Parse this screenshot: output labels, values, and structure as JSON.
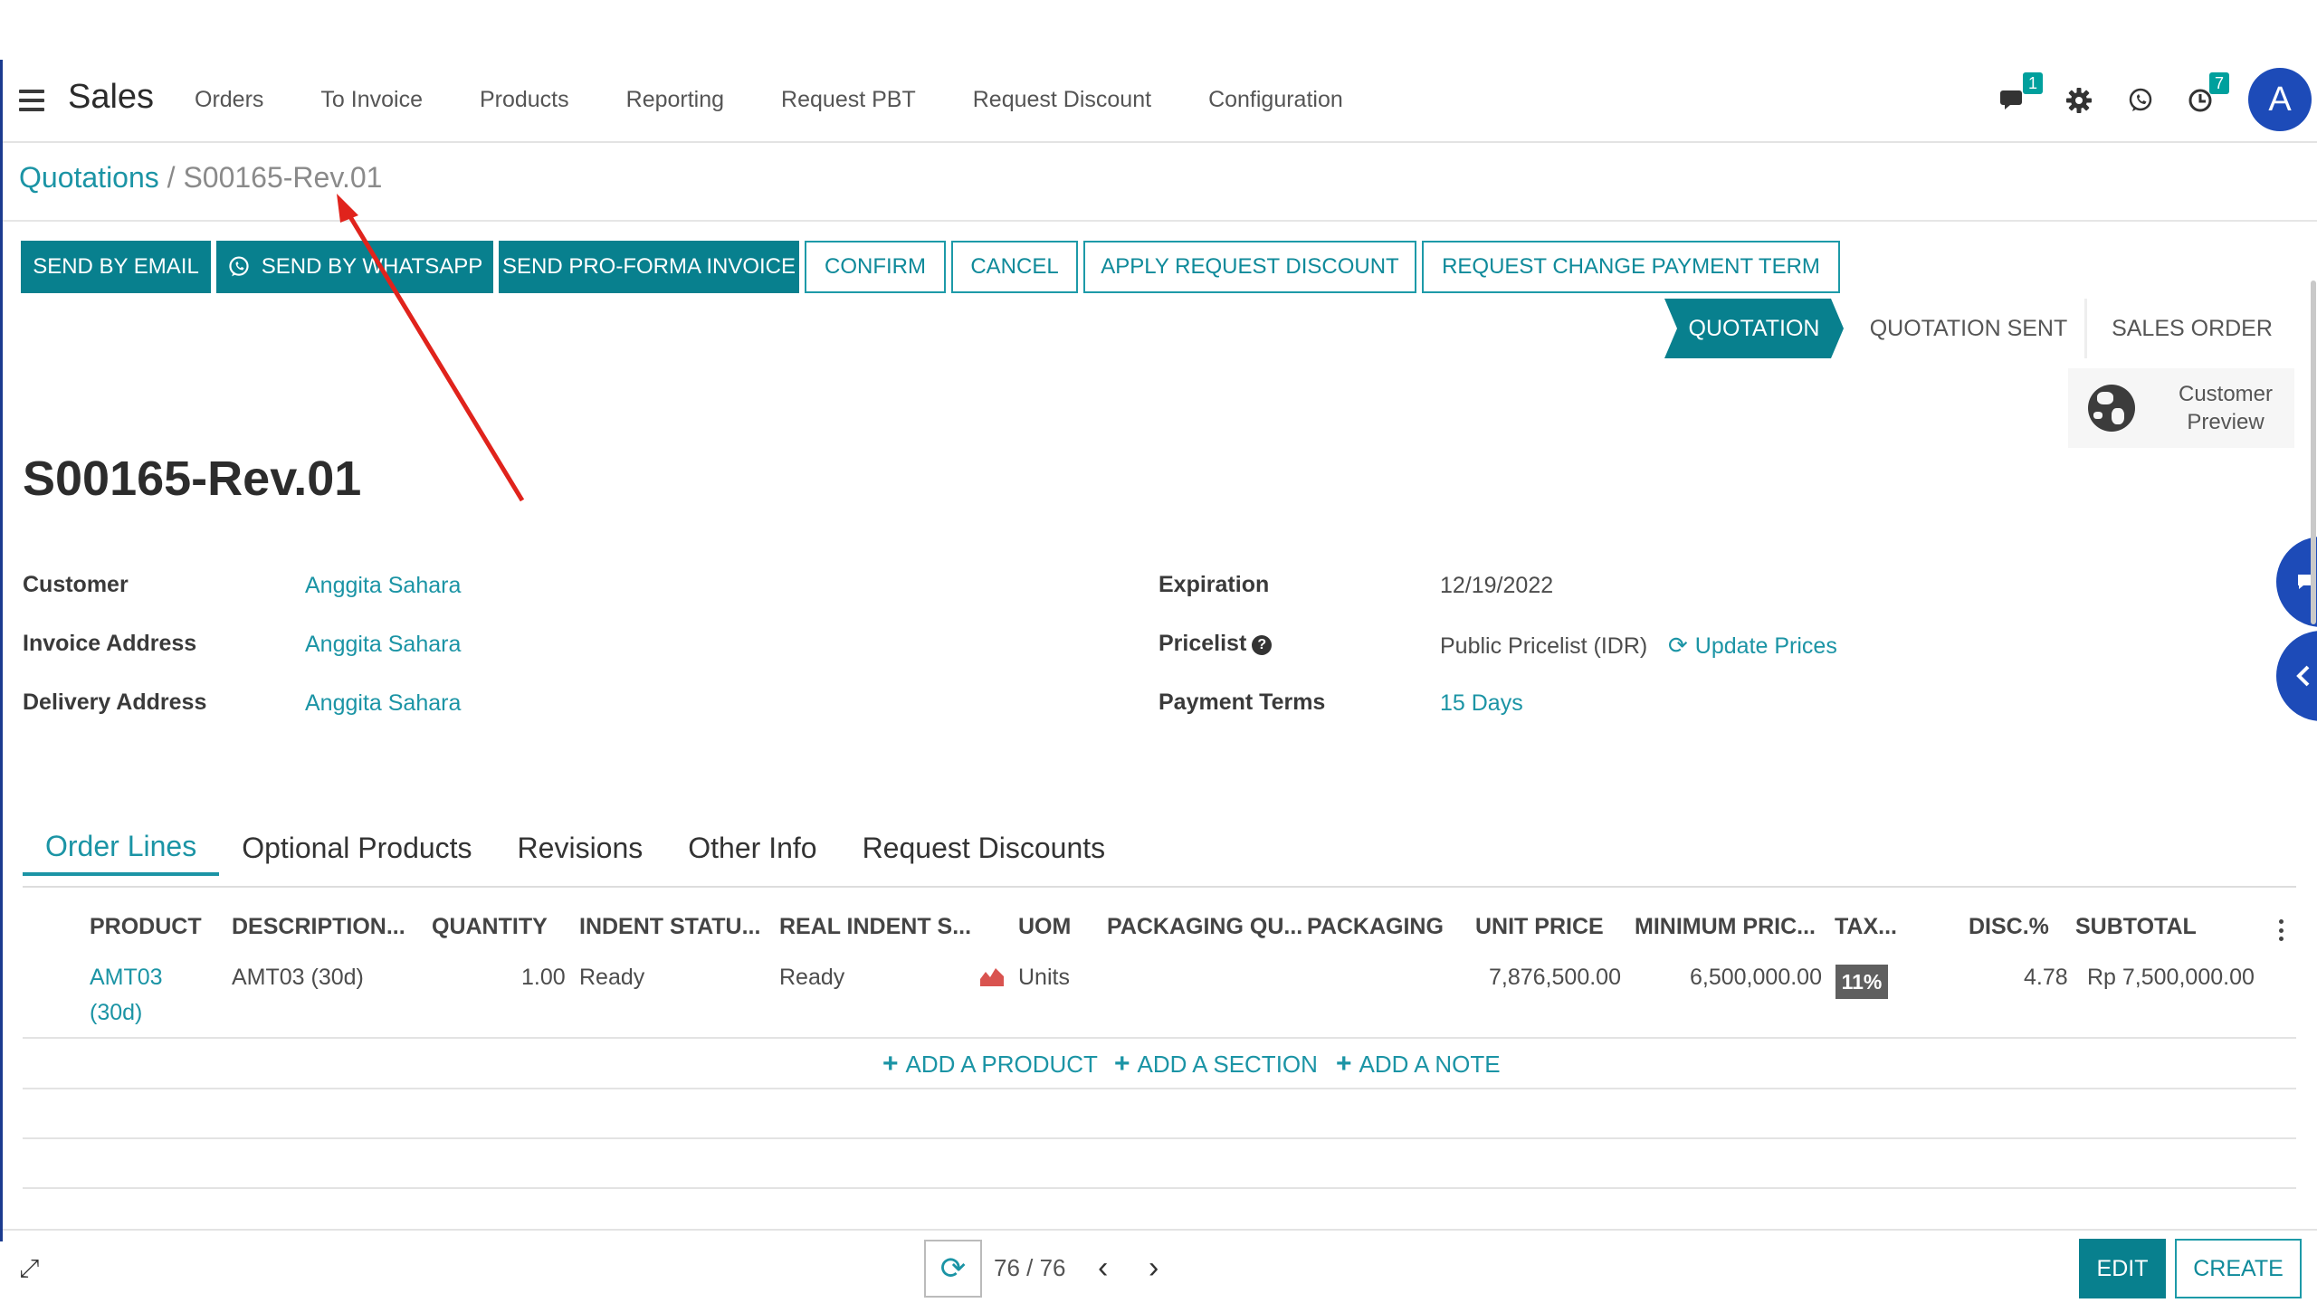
{
  "navbar": {
    "app_name": "Sales",
    "menu": [
      "Orders",
      "To Invoice",
      "Products",
      "Reporting",
      "Request PBT",
      "Request Discount",
      "Configuration"
    ],
    "messages_badge": "1",
    "activity_badge": "7",
    "avatar_letter": "A"
  },
  "breadcrumb": {
    "parent": "Quotations",
    "separator": " / ",
    "current": "S00165-Rev.01"
  },
  "buttons": {
    "send_email": "SEND BY EMAIL",
    "send_whatsapp": "SEND BY WHATSAPP",
    "send_proforma": "SEND PRO-FORMA INVOICE",
    "confirm": "CONFIRM",
    "cancel": "CANCEL",
    "apply_discount": "APPLY REQUEST DISCOUNT",
    "change_payment_term": "REQUEST CHANGE PAYMENT TERM"
  },
  "statusbar": [
    "QUOTATION",
    "QUOTATION SENT",
    "SALES ORDER"
  ],
  "preview": {
    "line1": "Customer",
    "line2": "Preview"
  },
  "record": {
    "name": "S00165-Rev.01",
    "customer_label": "Customer",
    "customer": "Anggita Sahara",
    "invoice_label": "Invoice Address",
    "invoice": "Anggita Sahara",
    "delivery_label": "Delivery Address",
    "delivery": "Anggita Sahara",
    "expiration_label": "Expiration",
    "expiration": "12/19/2022",
    "pricelist_label": "Pricelist",
    "pricelist_help": "?",
    "pricelist": "Public Pricelist (IDR)",
    "update_prices": "Update Prices",
    "payment_terms_label": "Payment Terms",
    "payment_terms": "15 Days"
  },
  "tabs": [
    "Order Lines",
    "Optional Products",
    "Revisions",
    "Other Info",
    "Request Discounts"
  ],
  "table": {
    "headers": [
      "PRODUCT",
      "DESCRIPTION...",
      "QUANTITY",
      "INDENT STATU...",
      "REAL INDENT S...",
      "UOM",
      "PACKAGING QU...",
      "PACKAGING",
      "UNIT PRICE",
      "MINIMUM PRIC...",
      "TAX...",
      "DISC.%",
      "SUBTOTAL"
    ],
    "rows": [
      {
        "product_line1": "AMT03",
        "product_line2": "(30d)",
        "description": "AMT03 (30d)",
        "quantity": "1.00",
        "indent_status": "Ready",
        "real_indent": "Ready",
        "uom": "Units",
        "unit_price": "7,876,500.00",
        "minimum_price": "6,500,000.00",
        "tax": "11%",
        "discount": "4.78",
        "subtotal": "Rp 7,500,000.00"
      }
    ],
    "add_product": "ADD A PRODUCT",
    "add_section": "ADD A SECTION",
    "add_note": "ADD A NOTE"
  },
  "pager": {
    "value": "76 / 76"
  },
  "footer": {
    "edit": "EDIT",
    "create": "CREATE"
  },
  "colors": {
    "teal": "#08808e",
    "link": "#1b94a5",
    "avatar": "#1d4bb8",
    "annotation": "#e0231c"
  }
}
